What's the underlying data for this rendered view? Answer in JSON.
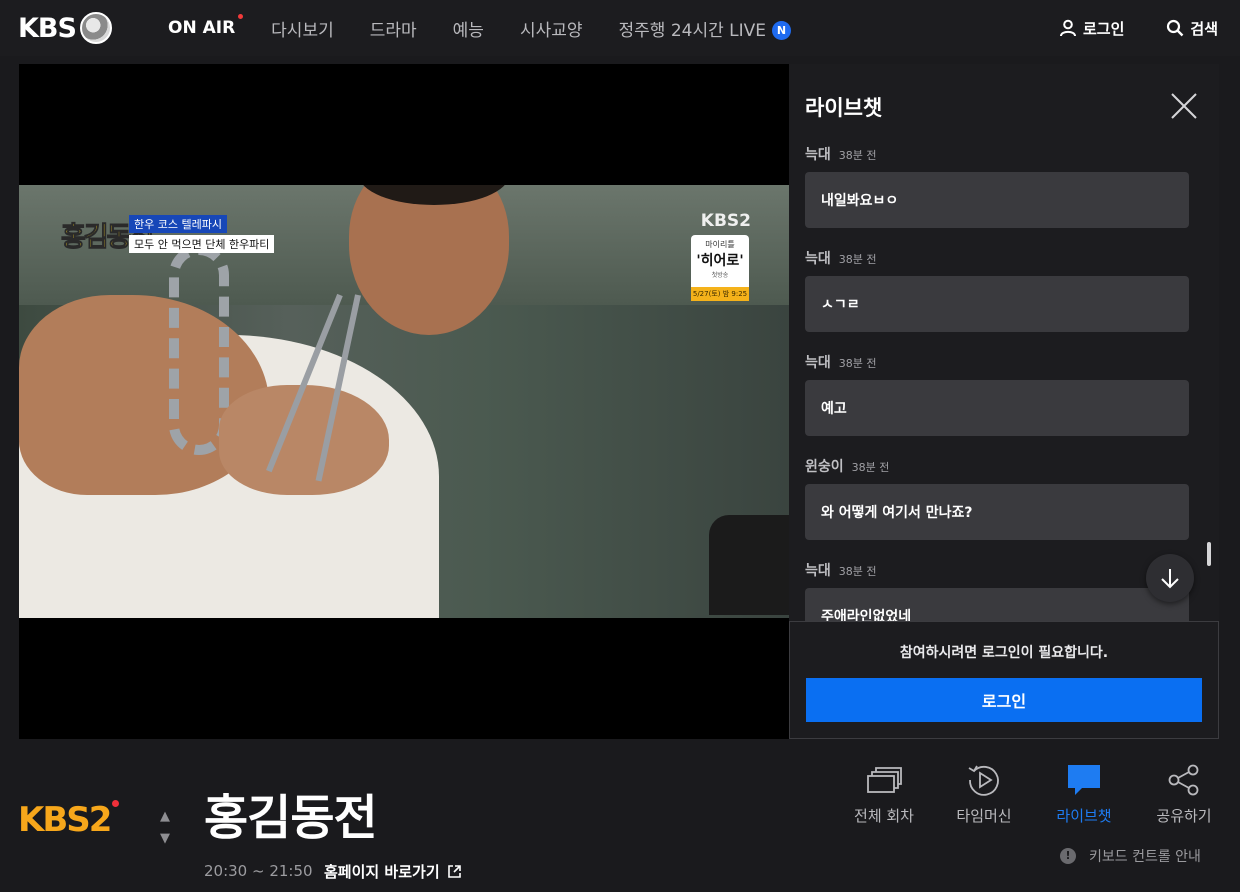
{
  "header": {
    "logo_text": "KBS",
    "nav": [
      {
        "label": "ON AIR",
        "active": true
      },
      {
        "label": "다시보기"
      },
      {
        "label": "드라마"
      },
      {
        "label": "예능"
      },
      {
        "label": "시사교양"
      },
      {
        "label": "정주행 24시간 LIVE",
        "badge": "N"
      }
    ],
    "login_label": "로그인",
    "search_label": "검색"
  },
  "video_overlay": {
    "show_logo": "홍김동전",
    "caption_line1": "한우 코스 텔레파시",
    "caption_line2": "모두 안 먹으면 단체 한우파티",
    "channel_bug": "KBS2",
    "promo_line1": "마이리틀",
    "promo_line2": "'히어로'",
    "promo_line3": "첫방송",
    "promo_date": "5/27(토) 밤 9:25"
  },
  "chat": {
    "title": "라이브챗",
    "messages": [
      {
        "nick": "늑대",
        "time": "38분 전",
        "text": "내일봐요ㅂㅇ"
      },
      {
        "nick": "늑대",
        "time": "38분 전",
        "text": "ㅅㄱㄹ"
      },
      {
        "nick": "늑대",
        "time": "38분 전",
        "text": "예고"
      },
      {
        "nick": "윈숭이",
        "time": "38분 전",
        "text": "와 어떻게 여기서 만나죠?"
      },
      {
        "nick": "늑대",
        "time": "38분 전",
        "text": "주애라인없었네"
      }
    ],
    "login_prompt": "참여하시려면 로그인이 필요합니다.",
    "login_button": "로그인"
  },
  "program": {
    "channel_logo": "KBS2",
    "title": "홍김동전",
    "time": "20:30 ~ 21:50",
    "homepage_link": "홈페이지 바로가기"
  },
  "actions": [
    {
      "label": "전체 회차",
      "icon": "episodes-icon"
    },
    {
      "label": "타임머신",
      "icon": "timemachine-icon"
    },
    {
      "label": "라이브챗",
      "icon": "chat-icon",
      "active": true
    },
    {
      "label": "공유하기",
      "icon": "share-icon"
    }
  ],
  "keyboard_guide": "키보드 컨트롤 안내",
  "colors": {
    "accent": "#0a6ff2",
    "active_action": "#1e7cf2",
    "channel_orange": "#f7a71b",
    "live_dot": "#f23a3a"
  }
}
